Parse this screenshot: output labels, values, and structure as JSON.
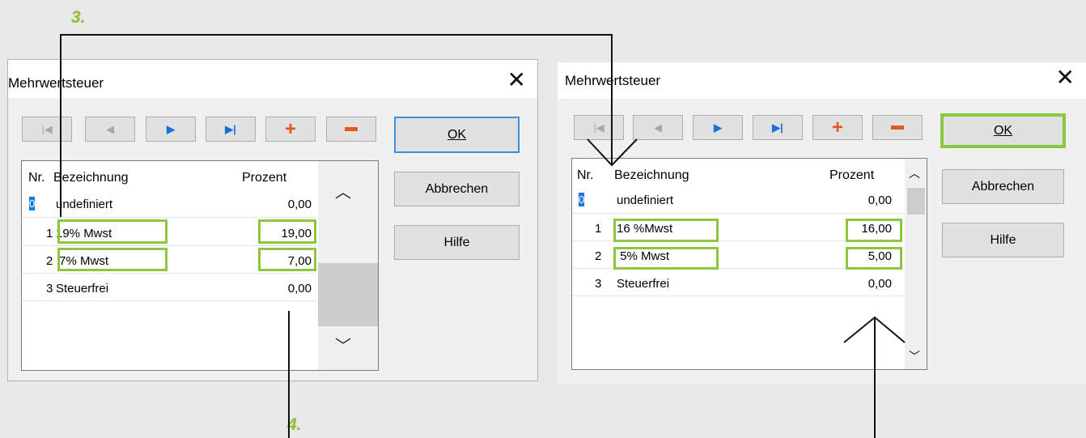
{
  "annotations": {
    "step3": "3.",
    "step4": "4."
  },
  "dialog_left": {
    "title": "Mehrwertsteuer",
    "ok": "OK",
    "cancel": "Abbrechen",
    "help": "Hilfe",
    "columns": {
      "nr": "Nr.",
      "name": "Bezeichnung",
      "percent": "Prozent"
    },
    "rows": [
      {
        "nr": "0",
        "name": "undefiniert",
        "percent": "0,00"
      },
      {
        "nr": "1",
        "name": "19% Mwst",
        "percent": "19,00"
      },
      {
        "nr": "2",
        "name": " 7% Mwst",
        "percent": "7,00"
      },
      {
        "nr": "3",
        "name": "Steuerfrei",
        "percent": "0,00"
      }
    ]
  },
  "dialog_right": {
    "title": "Mehrwertsteuer",
    "ok": "OK",
    "cancel": "Abbrechen",
    "help": "Hilfe",
    "columns": {
      "nr": "Nr.",
      "name": "Bezeichnung",
      "percent": "Prozent"
    },
    "rows": [
      {
        "nr": "0",
        "name": "undefiniert",
        "percent": "0,00"
      },
      {
        "nr": "1",
        "name": "16 %Mwst",
        "percent": "16,00"
      },
      {
        "nr": "2",
        "name": " 5% Mwst",
        "percent": "5,00"
      },
      {
        "nr": "3",
        "name": "Steuerfrei",
        "percent": "0,00"
      }
    ]
  },
  "icons": {
    "close": "close-icon",
    "first": "first-record-icon",
    "prev": "prev-record-icon",
    "next": "next-record-icon",
    "last": "last-record-icon",
    "add": "add-record-icon",
    "delete": "delete-record-icon"
  },
  "colors": {
    "highlight": "#8dc63f",
    "step_label": "#8dbf2a",
    "nav_blue": "#1a6ed8",
    "nav_orange": "#e05a1f"
  }
}
